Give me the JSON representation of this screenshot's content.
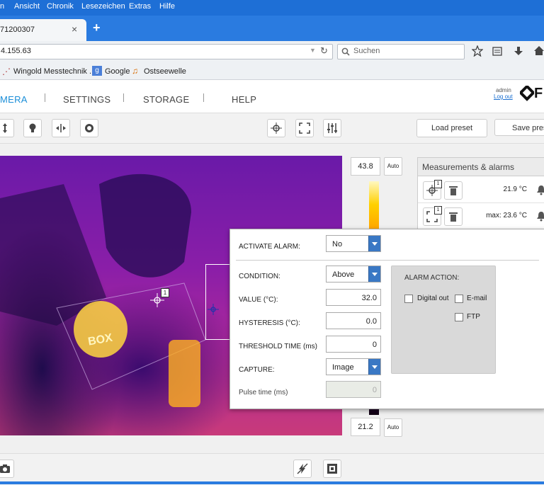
{
  "browser": {
    "menu": [
      "n",
      "Ansicht",
      "Chronik",
      "Lesezeichen",
      "Extras",
      "Hilfe"
    ],
    "tab_title": "71200307",
    "new_tab": "+",
    "tab_close": "×",
    "url": "4.155.63",
    "search_placeholder": "Suchen",
    "bookmarks": [
      "Wingold Messtechnik ...",
      "Google",
      "Ostseewelle"
    ]
  },
  "nav": {
    "items": [
      "MERA",
      "SETTINGS",
      "STORAGE",
      "HELP"
    ],
    "active": "MERA",
    "user": "admin",
    "logout": "Log out",
    "brand": "F"
  },
  "toolbar": {
    "load_preset": "Load preset",
    "save_preset": "Save pres"
  },
  "scale": {
    "max": "43.8",
    "min": "21.2",
    "auto": "Auto"
  },
  "image_markers": {
    "spot1": "1"
  },
  "measurements": {
    "title": "Measurements & alarms",
    "rows": [
      {
        "badge": "1",
        "value": "21.9 °C"
      },
      {
        "badge": "1",
        "value": "max: 23.6 °C"
      }
    ]
  },
  "alarm_popup": {
    "activate_label": "ACTIVATE ALARM:",
    "activate_value": "No",
    "condition_label": "CONDITION:",
    "condition_value": "Above",
    "value_label": "VALUE (°C):",
    "value_value": "32.0",
    "hysteresis_label": "HYSTERESIS (°C):",
    "hysteresis_value": "0.0",
    "threshold_label": "THRESHOLD TIME (ms)",
    "threshold_value": "0",
    "capture_label": "CAPTURE:",
    "capture_value": "Image",
    "pulse_label": "Pulse time (ms)",
    "pulse_value": "0",
    "action_title": "ALARM ACTION:",
    "digital_out": "Digital out",
    "email": "E-mail",
    "ftp": "FTP"
  },
  "colors": {
    "accent": "#1e6fd6",
    "active_nav": "#1a8ed8",
    "select_arrow": "#3a78c4"
  }
}
